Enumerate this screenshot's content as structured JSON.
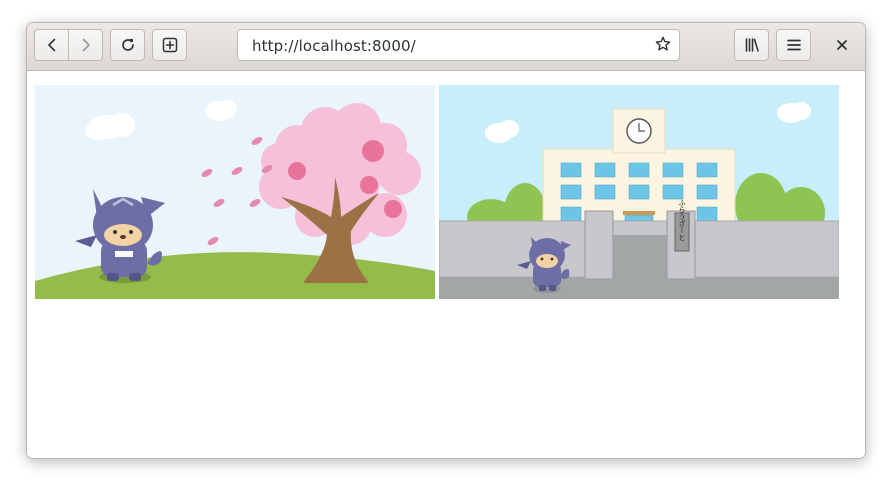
{
  "browser": {
    "url": "http://localhost:8000/",
    "icons": {
      "back": "chevron-left-icon",
      "forward": "chevron-right-icon",
      "reload": "reload-icon",
      "new_tab": "new-tab-icon",
      "bookmark": "star-icon",
      "library": "library-icon",
      "menu": "hamburger-menu-icon",
      "close": "close-icon"
    }
  },
  "page": {
    "images": [
      {
        "scene": "ninja cat standing by a cherry blossom tree"
      },
      {
        "scene": "ninja cat in front of a school building"
      }
    ],
    "school_gate_sign": "ふらうざーと"
  },
  "colors": {
    "toolbar": "#e4e1de",
    "sky1": "#eaf4fd",
    "sky2": "#c8eefb",
    "grass": "#95bb4a",
    "blossom": "#f5c0d8",
    "ninja": "#6e6ea6"
  }
}
